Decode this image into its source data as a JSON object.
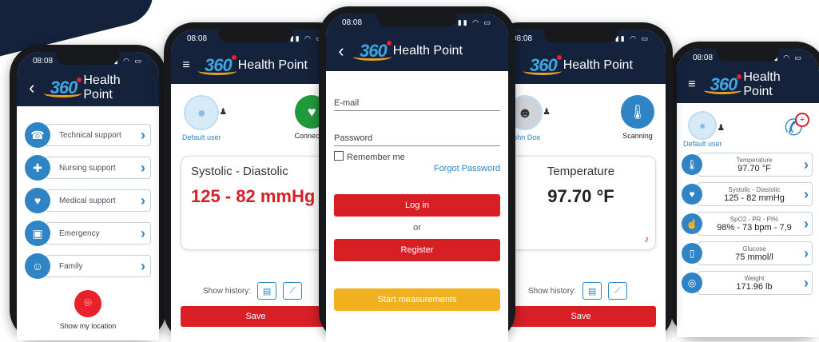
{
  "brand": {
    "logo_text": "360",
    "name": "Health Point"
  },
  "status": {
    "time": "08:08",
    "icons": "▮▮ ◠ ▭"
  },
  "nav": {
    "back": "‹",
    "menu": "≡"
  },
  "phone1": {
    "menu": [
      {
        "label": "Technical support",
        "icon": "headset-icon",
        "glyph": "☎"
      },
      {
        "label": "Nursing support",
        "icon": "nurse-cap-icon",
        "glyph": "✚"
      },
      {
        "label": "Medical support",
        "icon": "stethoscope-icon",
        "glyph": "♥"
      },
      {
        "label": "Emergency",
        "icon": "ambulance-icon",
        "glyph": "▣"
      },
      {
        "label": "Family",
        "icon": "family-icon",
        "glyph": "☺"
      }
    ],
    "location_label": "Show my location"
  },
  "phone2": {
    "user_label": "Default user",
    "device_label": "Connected",
    "reading_title": "Systolic - Diastolic",
    "reading_value": "125 - 82 mmHg",
    "history_label": "Show history:",
    "save_label": "Save"
  },
  "phone3": {
    "email_label": "E-mail",
    "password_label": "Password",
    "remember_label": "Remember me",
    "forgot_label": "Forgot Password",
    "login_label": "Log in",
    "or_label": "or",
    "register_label": "Register",
    "start_label": "Start measurements"
  },
  "phone4": {
    "user_label": "John Doe",
    "device_label": "Scanning",
    "reading_title": "Temperature",
    "reading_value": "97.70 °F",
    "history_label": "Show history:",
    "save_label": "Save"
  },
  "phone5": {
    "user_label": "Default user",
    "vitals": [
      {
        "label": "Temperature",
        "value": "97.70 °F",
        "icon": "thermometer-icon",
        "glyph": "🌡"
      },
      {
        "label": "Systolic - Diastolic",
        "value": "125 - 82 mmHg",
        "icon": "blood-pressure-icon",
        "glyph": "♥"
      },
      {
        "label": "SpO2 - PR - PI%",
        "value": "98% - 73 bpm - 7,9",
        "icon": "oximeter-icon",
        "glyph": "☝"
      },
      {
        "label": "Glucose",
        "value": "75 mmol/l",
        "icon": "glucometer-icon",
        "glyph": "▯"
      },
      {
        "label": "Weight",
        "value": "171.96 lb",
        "icon": "scale-icon",
        "glyph": "◎"
      }
    ]
  },
  "colors": {
    "navy": "#15223c",
    "accent_blue": "#2f84c6",
    "red": "#d81f26",
    "yellow": "#f2b01e",
    "green": "#1f9a3a"
  }
}
